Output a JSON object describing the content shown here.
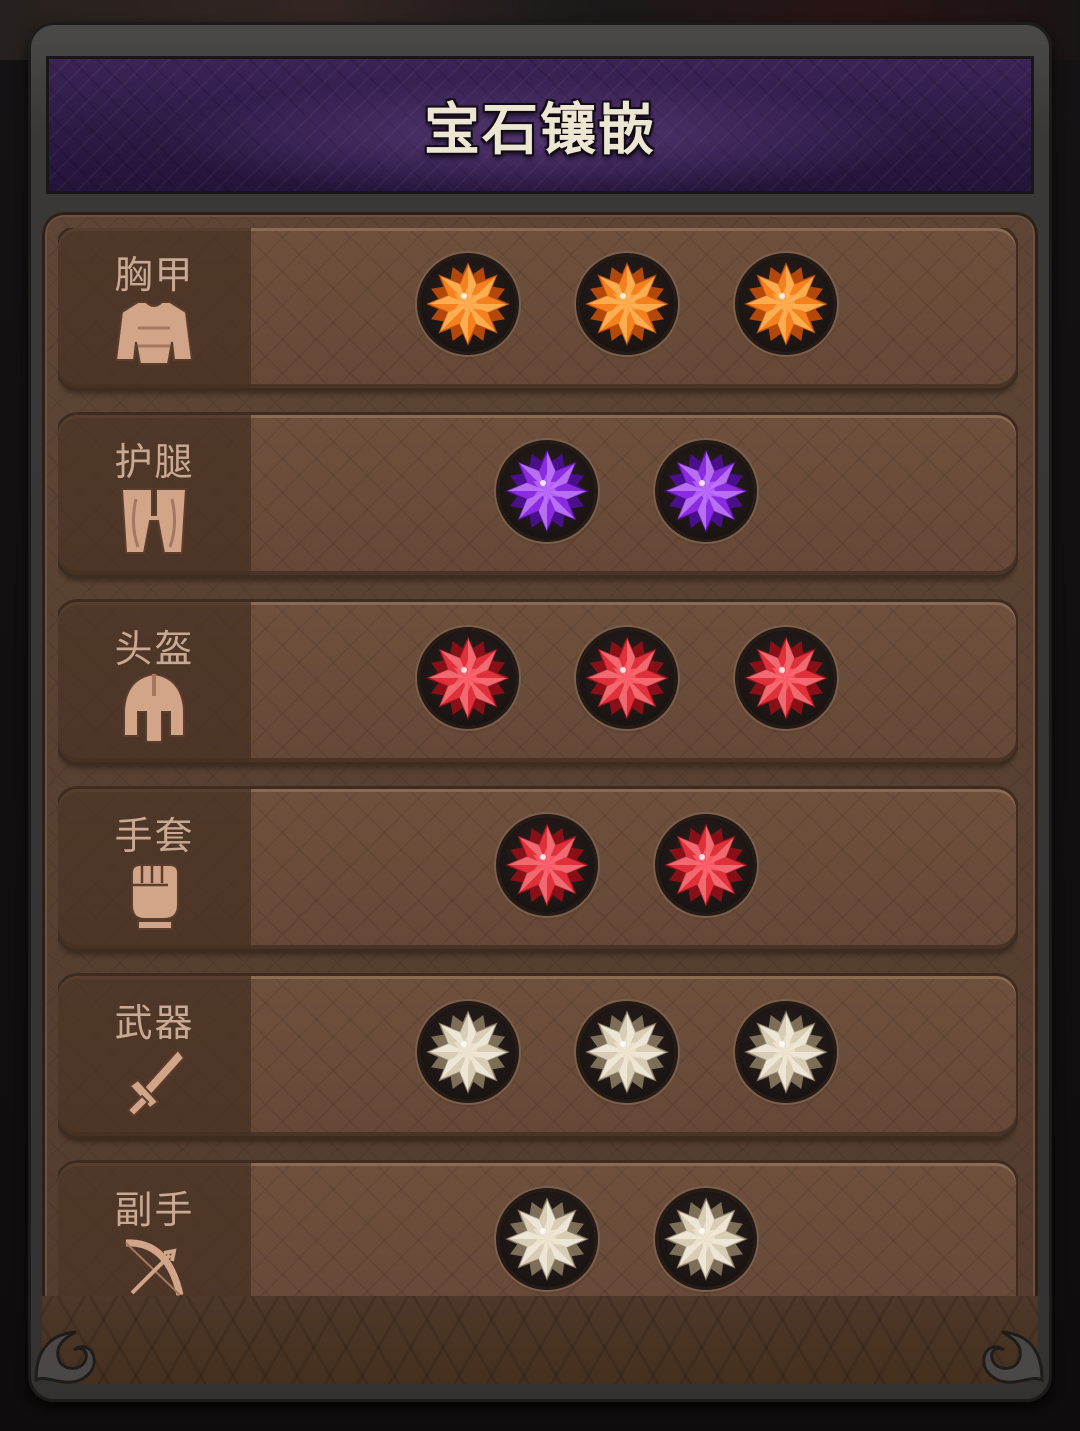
{
  "title": "宝石镶嵌",
  "colors": {
    "title_bg": "#2c1a44",
    "panel_bg": "#5e4535",
    "row_bg": "#6f503d",
    "label_color": "#c9a993",
    "gem_orange": "#f5801e",
    "gem_purple": "#8a2be2",
    "gem_red": "#e0303a",
    "gem_white": "#d8ccb4"
  },
  "slots": [
    {
      "label": "胸甲",
      "icon": "chest-armor-icon",
      "gems": [
        "orange",
        "orange",
        "orange"
      ]
    },
    {
      "label": "护腿",
      "icon": "leg-armor-icon",
      "gems": [
        "purple",
        "purple"
      ]
    },
    {
      "label": "头盔",
      "icon": "helmet-icon",
      "gems": [
        "red",
        "red",
        "red"
      ]
    },
    {
      "label": "手套",
      "icon": "gloves-fist-icon",
      "gems": [
        "red",
        "red"
      ]
    },
    {
      "label": "武器",
      "icon": "sword-icon",
      "gems": [
        "white",
        "white",
        "white"
      ]
    },
    {
      "label": "副手",
      "icon": "bow-offhand-icon",
      "gems": [
        "white",
        "white"
      ]
    }
  ]
}
